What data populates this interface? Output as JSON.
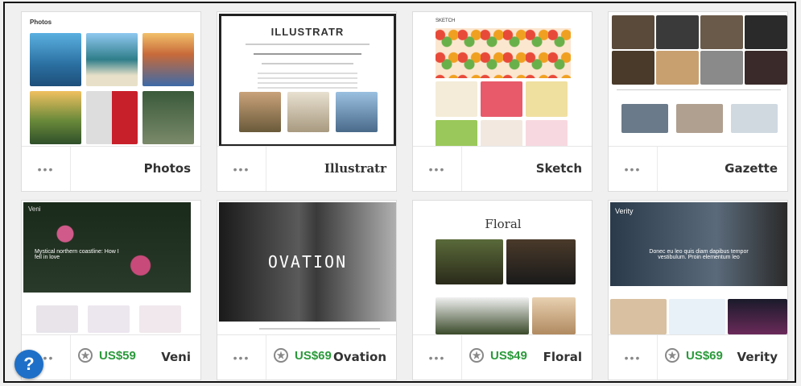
{
  "themes": [
    {
      "name": "Photos",
      "price": "",
      "mini_title": "Photos"
    },
    {
      "name": "Illustratr",
      "price": "",
      "mini_title": "ILLUSTRATR"
    },
    {
      "name": "Sketch",
      "price": "",
      "mini_title": "SKETCH"
    },
    {
      "name": "Gazette",
      "price": "",
      "mini_title": ""
    },
    {
      "name": "Veni",
      "price": "US$59",
      "mini_title": "Veni"
    },
    {
      "name": "Ovation",
      "price": "US$69",
      "mini_title": "OVATION"
    },
    {
      "name": "Floral",
      "price": "US$49",
      "mini_title": "Floral"
    },
    {
      "name": "Verity",
      "price": "US$69",
      "mini_title": "Verity"
    }
  ],
  "ui": {
    "dots": "•••",
    "star_glyph": "★",
    "help_glyph": "?",
    "veni_caption": "Mystical northern coastline: How I fell in love",
    "verity_caption": "Donec eu leo quis diam dapibus tempor vestibulum. Proin elementum leo"
  }
}
